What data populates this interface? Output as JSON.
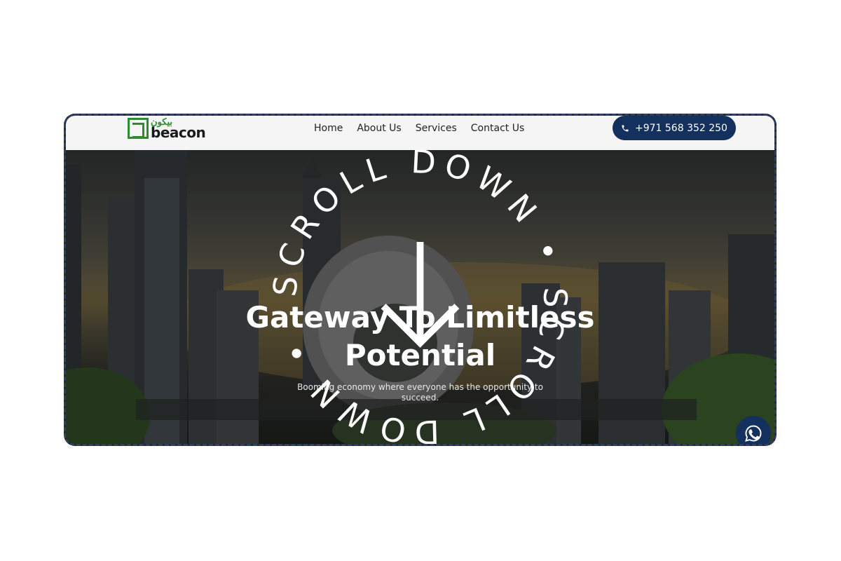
{
  "brand": {
    "name": "beacon",
    "arabic_name": "بيكون",
    "primary_color": "#2e8b2e",
    "accent_color": "#13305e"
  },
  "nav": {
    "items": [
      {
        "label": "Home"
      },
      {
        "label": "About Us"
      },
      {
        "label": "Services"
      },
      {
        "label": "Contact Us"
      }
    ],
    "phone": {
      "icon": "phone-icon",
      "label": "+971 568 352 250"
    }
  },
  "hero": {
    "title_line1": "Gateway To Limitless",
    "title_line2": "Potential",
    "subtitle_line1": "Booming economy where everyone has the opportunity to",
    "subtitle_line2": "succeed.",
    "scroll_text": "SCROLL DOWN • SCROLL DOWN •",
    "scroll_icon": "arrow-down-icon"
  },
  "floating": {
    "whatsapp_icon": "whatsapp-icon"
  }
}
